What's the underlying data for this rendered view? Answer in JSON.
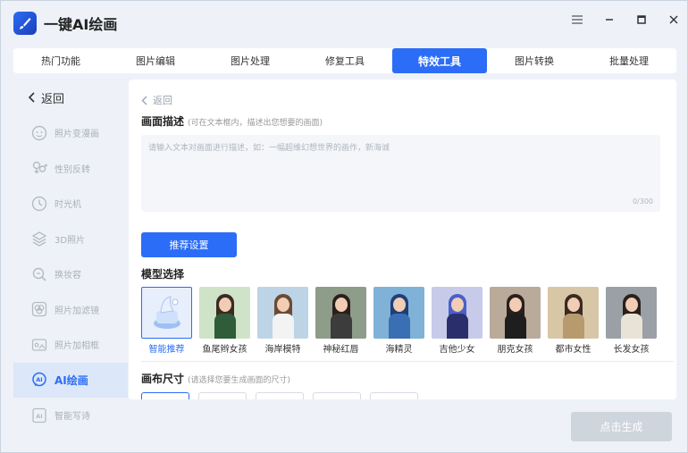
{
  "app": {
    "title": "一键AI绘画"
  },
  "tabs": [
    {
      "label": "热门功能"
    },
    {
      "label": "图片编辑"
    },
    {
      "label": "图片处理"
    },
    {
      "label": "修复工具"
    },
    {
      "label": "特效工具",
      "active": true
    },
    {
      "label": "图片转换"
    },
    {
      "label": "批量处理"
    }
  ],
  "sidebar": {
    "back_label": "返回",
    "items": [
      {
        "label": "照片变漫画",
        "icon": "face-icon"
      },
      {
        "label": "性别反转",
        "icon": "gender-icon"
      },
      {
        "label": "时光机",
        "icon": "clock-icon"
      },
      {
        "label": "3D照片",
        "icon": "layers-icon"
      },
      {
        "label": "换妆容",
        "icon": "makeup-icon"
      },
      {
        "label": "照片加滤镜",
        "icon": "filter-icon"
      },
      {
        "label": "照片加相框",
        "icon": "frame-icon"
      },
      {
        "label": "AI绘画",
        "icon": "ai-icon",
        "active": true
      },
      {
        "label": "智能写诗",
        "icon": "ai-poem-icon"
      }
    ]
  },
  "main": {
    "back_label": "返回",
    "description": {
      "title": "画面描述",
      "hint": "(可在文本框内，描述出您想要的画面)",
      "placeholder": "请输入文本对画面进行描述，如：一幅超维幻想世界的画作，新海诚",
      "value": "",
      "counter": "0/300"
    },
    "recommend_button": "推荐设置",
    "model_section_title": "模型选择",
    "models": [
      {
        "label": "智能推荐",
        "selected": true,
        "icon": "smart-recommend-icon"
      },
      {
        "label": "鱼尾辫女孩",
        "hair": "#3b2a22",
        "outfit": "#2f5c3a",
        "bg": "#cfe3c8"
      },
      {
        "label": "海岸模特",
        "hair": "#6b4a33",
        "outfit": "#f3f3f3",
        "bg": "#bcd4e6"
      },
      {
        "label": "神秘红唇",
        "hair": "#2a1f1b",
        "outfit": "#3c3c3c",
        "bg": "#8e9c8a"
      },
      {
        "label": "海精灵",
        "hair": "#1d3f7a",
        "outfit": "#3a6fb4",
        "bg": "#7fb2d6"
      },
      {
        "label": "吉他少女",
        "hair": "#4a5fc9",
        "outfit": "#2a2f6b",
        "bg": "#c7cbe9"
      },
      {
        "label": "朋克女孩",
        "hair": "#2a1f1b",
        "outfit": "#1e1e1e",
        "bg": "#b9aa9a"
      },
      {
        "label": "都市女性",
        "hair": "#3b2a22",
        "outfit": "#b79b6e",
        "bg": "#d8c7a6"
      },
      {
        "label": "长发女孩",
        "hair": "#2a1f1b",
        "outfit": "#e9e2d6",
        "bg": "#9aa0a6"
      }
    ],
    "canvas": {
      "title": "画布尺寸",
      "hint": "(请选择您要生成画面的尺寸)"
    }
  },
  "generate_button": "点击生成",
  "colors": {
    "accent": "#2b6df6",
    "disabled": "#cfd5dd"
  }
}
